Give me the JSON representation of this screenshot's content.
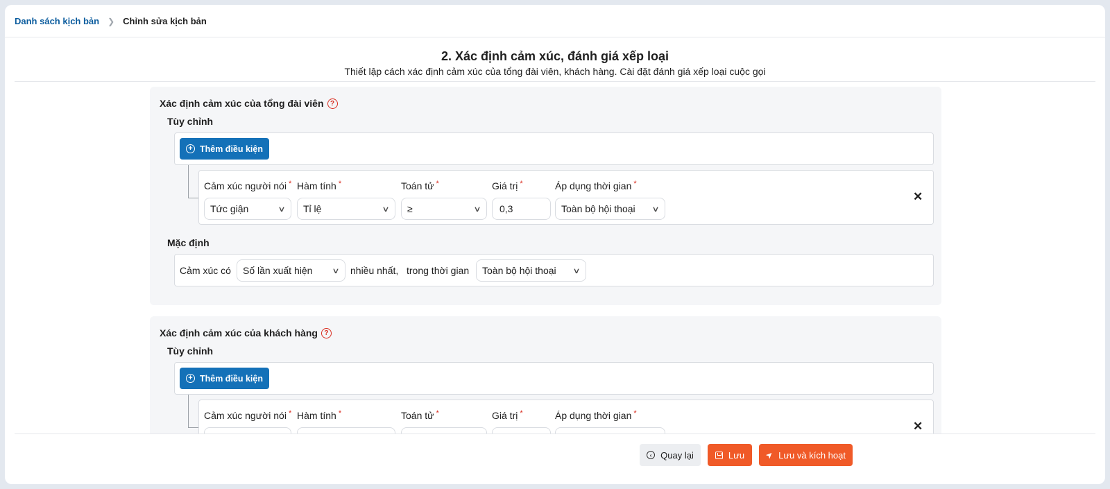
{
  "breadcrumb": {
    "parent": "Danh sách kịch bản",
    "current": "Chỉnh sửa kịch bản"
  },
  "heading": {
    "title": "2. Xác định cảm xúc, đánh giá xếp loại",
    "subtitle": "Thiết lập cách xác định cảm xúc của tổng đài viên, khách hàng. Cài đặt đánh giá xếp loại cuộc gọi"
  },
  "agent_section": {
    "title": "Xác định cảm xúc của tổng đài viên",
    "custom_label": "Tùy chỉnh",
    "add_condition": "Thêm điều kiện",
    "condition": {
      "speaker_label": "Cảm xúc người nói",
      "speaker_value": "Tức giận",
      "func_label": "Hàm tính",
      "func_value": "Tỉ lệ",
      "op_label": "Toán tử",
      "op_value": "≥",
      "value_label": "Giá trị",
      "value_value": "0,3",
      "time_label": "Áp dụng thời gian",
      "time_value": "Toàn bộ hội thoại"
    },
    "default_label": "Mặc định",
    "default_row": {
      "prefix": "Cảm xúc có",
      "metric_value": "Số lần xuất hiện",
      "middle": "nhiều nhất,",
      "time_prefix": "trong thời gian",
      "time_value": "Toàn bộ hội thoại"
    }
  },
  "customer_section": {
    "title": "Xác định cảm xúc của khách hàng",
    "custom_label": "Tùy chỉnh",
    "add_condition": "Thêm điều kiện",
    "condition": {
      "speaker_label": "Cảm xúc người nói",
      "func_label": "Hàm tính",
      "op_label": "Toán tử",
      "value_label": "Giá trị",
      "time_label": "Áp dụng thời gian"
    }
  },
  "required_mark": "*",
  "help_glyph": "?",
  "footer": {
    "back": "Quay lại",
    "save": "Lưu",
    "save_activate": "Lưu và kích hoạt"
  },
  "icons": {
    "plus": "plus-circle-icon",
    "chevron": "chevron-down-icon",
    "close": "close-icon",
    "help": "help-circle-icon",
    "back": "back-icon",
    "save": "save-icon",
    "rocket": "rocket-icon"
  },
  "colors": {
    "primary_blue": "#1471b8",
    "accent_orange": "#f05a28",
    "required_red": "#d92d20",
    "link_blue": "#0b5c9e"
  }
}
